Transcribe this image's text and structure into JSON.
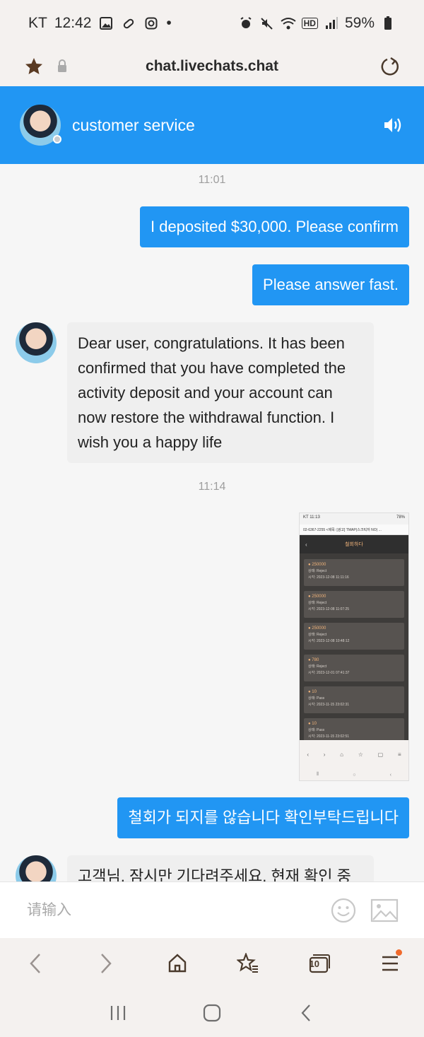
{
  "status_bar": {
    "carrier": "KT",
    "time": "12:42",
    "dot": "•",
    "hd": "HD",
    "battery": "59%"
  },
  "browser": {
    "url": "chat.livechats.chat",
    "tab_count": "10",
    "accent_color": "#f06a2c"
  },
  "chat": {
    "agent_name": "customer service",
    "header_color": "#2196f3",
    "input_placeholder": "请输入"
  },
  "messages": {
    "time1": "11:01",
    "out1": "I deposited $30,000. Please confirm",
    "out2": "Please answer fast.",
    "in1": "Dear user, congratulations. It has been confirmed that you have completed the activity deposit and your account can now restore the withdrawal function. I wish you a happy life",
    "time2": "11:14",
    "out3": "철회가 되지를 않습니다 확인부탁드립니다",
    "in2": "고객님, 잠시만 기다려주세요. 현재 확인 중"
  },
  "attached_screenshot": {
    "status": "KT 11:13",
    "battery": "78%",
    "phone": "02-6367-2255",
    "url_text": "<제목: [광고] TMAP(스크릭저 NO) ...",
    "title": "철회하다",
    "status_label": "상태:",
    "time_label": "시각:",
    "records": [
      {
        "amount": "250000",
        "status": "Reject",
        "time": "2023-12-08 11:11:16"
      },
      {
        "amount": "250000",
        "status": "Reject",
        "time": "2023-12-08 11:07:25"
      },
      {
        "amount": "250000",
        "status": "Reject",
        "time": "2023-12-08 10:48:12"
      },
      {
        "amount": "780",
        "status": "Reject",
        "time": "2023-12-01 07:41:37"
      },
      {
        "amount": "10",
        "status": "Pass",
        "time": "2023-11-15 23:02:31"
      },
      {
        "amount": "10",
        "status": "Pass",
        "time": "2023-11-15 23:02:51"
      }
    ]
  }
}
